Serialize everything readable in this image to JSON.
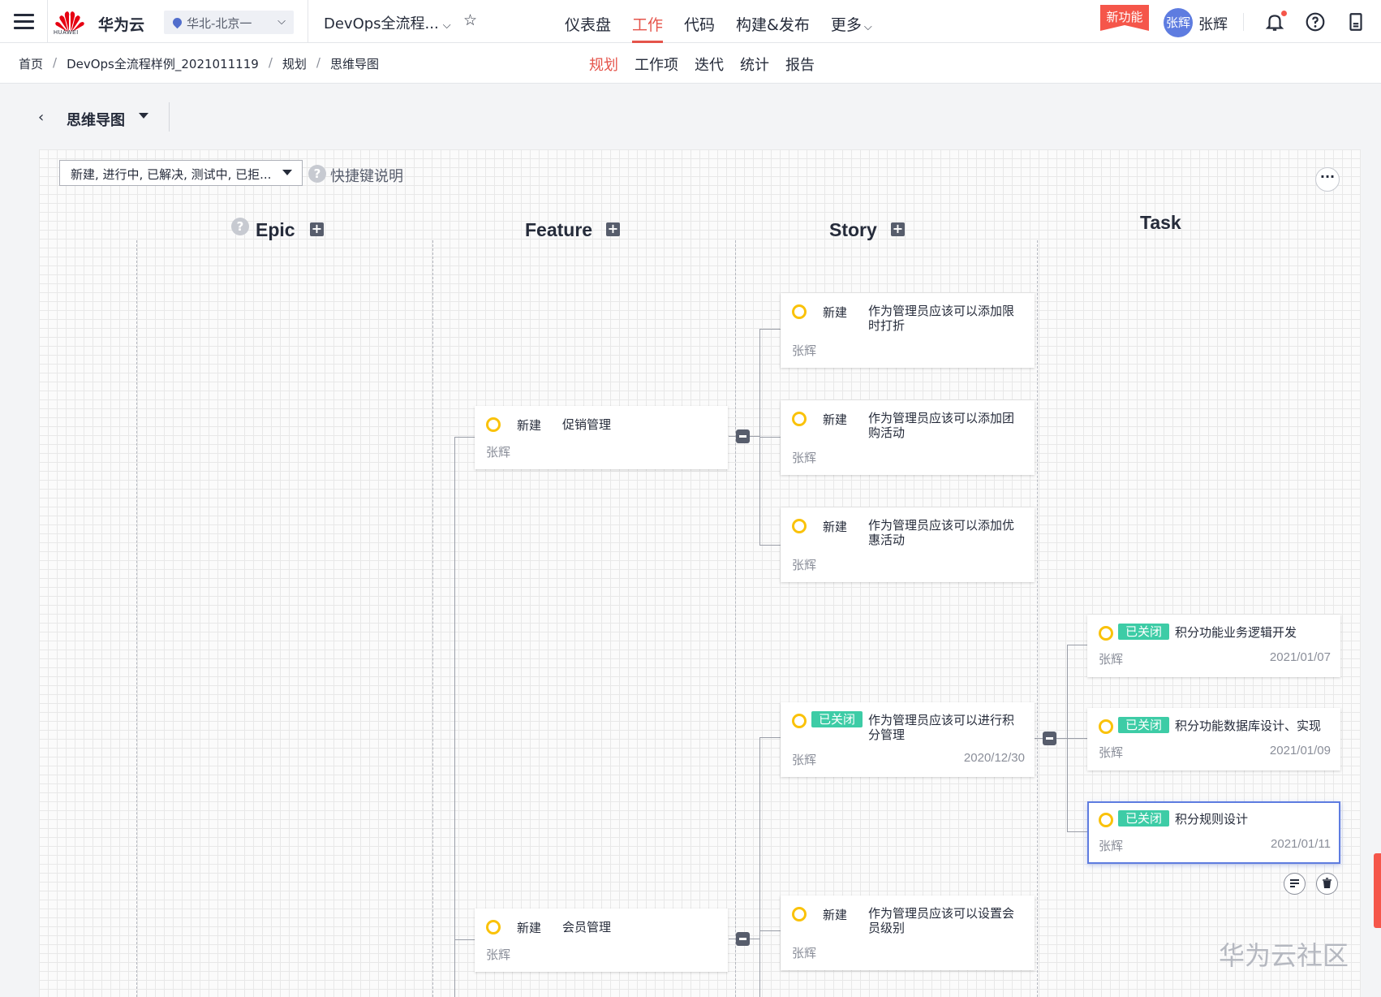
{
  "header": {
    "logo_text": "HUAWEI",
    "brand": "华为云",
    "region": "华北-北京一",
    "project": "DevOps全流程...",
    "nav": [
      {
        "label": "仪表盘",
        "active": false
      },
      {
        "label": "工作",
        "active": true
      },
      {
        "label": "代码",
        "active": false
      },
      {
        "label": "构建&发布",
        "active": false
      },
      {
        "label": "更多",
        "active": false
      }
    ],
    "new_feature": "新功能",
    "avatar_text": "张辉",
    "username": "张辉"
  },
  "breadcrumb": [
    "首页",
    "DevOps全流程样例_2021011119",
    "规划",
    "思维导图"
  ],
  "subnav": [
    {
      "label": "规划",
      "active": true
    },
    {
      "label": "工作项",
      "active": false
    },
    {
      "label": "迭代",
      "active": false
    },
    {
      "label": "统计",
      "active": false
    },
    {
      "label": "报告",
      "active": false
    }
  ],
  "page": {
    "title": "思维导图"
  },
  "toolbar": {
    "filter_value": "新建, 进行中, 已解决, 测试中, 已拒...",
    "shortcut_label": "快捷键说明"
  },
  "columns": {
    "epic": "Epic",
    "feature": "Feature",
    "story": "Story",
    "task": "Task"
  },
  "features": [
    {
      "status": "新建",
      "title": "促销管理",
      "owner": "张辉"
    },
    {
      "status": "新建",
      "title": "会员管理",
      "owner": "张辉"
    }
  ],
  "stories": [
    {
      "status": "新建",
      "title": "作为管理员应该可以添加限时打折",
      "owner": "张辉",
      "date": ""
    },
    {
      "status": "新建",
      "title": "作为管理员应该可以添加团购活动",
      "owner": "张辉",
      "date": ""
    },
    {
      "status": "新建",
      "title": "作为管理员应该可以添加优惠活动",
      "owner": "张辉",
      "date": ""
    },
    {
      "status": "已关闭",
      "title": "作为管理员应该可以进行积分管理",
      "owner": "张辉",
      "date": "2020/12/30"
    },
    {
      "status": "新建",
      "title": "作为管理员应该可以设置会员级别",
      "owner": "张辉",
      "date": ""
    }
  ],
  "tasks": [
    {
      "status": "已关闭",
      "title": "积分功能业务逻辑开发",
      "owner": "张辉",
      "date": "2021/01/07",
      "selected": false
    },
    {
      "status": "已关闭",
      "title": "积分功能数据库设计、实现",
      "owner": "张辉",
      "date": "2021/01/09",
      "selected": false
    },
    {
      "status": "已关闭",
      "title": "积分规则设计",
      "owner": "张辉",
      "date": "2021/01/11",
      "selected": true
    }
  ],
  "watermark": "华为云社区",
  "colors": {
    "accent": "#e5544b",
    "closed_badge": "#3dcca6",
    "status_circle": "#fac20a",
    "avatar": "#5e7ce0",
    "selected_border": "#5e7ce0"
  }
}
